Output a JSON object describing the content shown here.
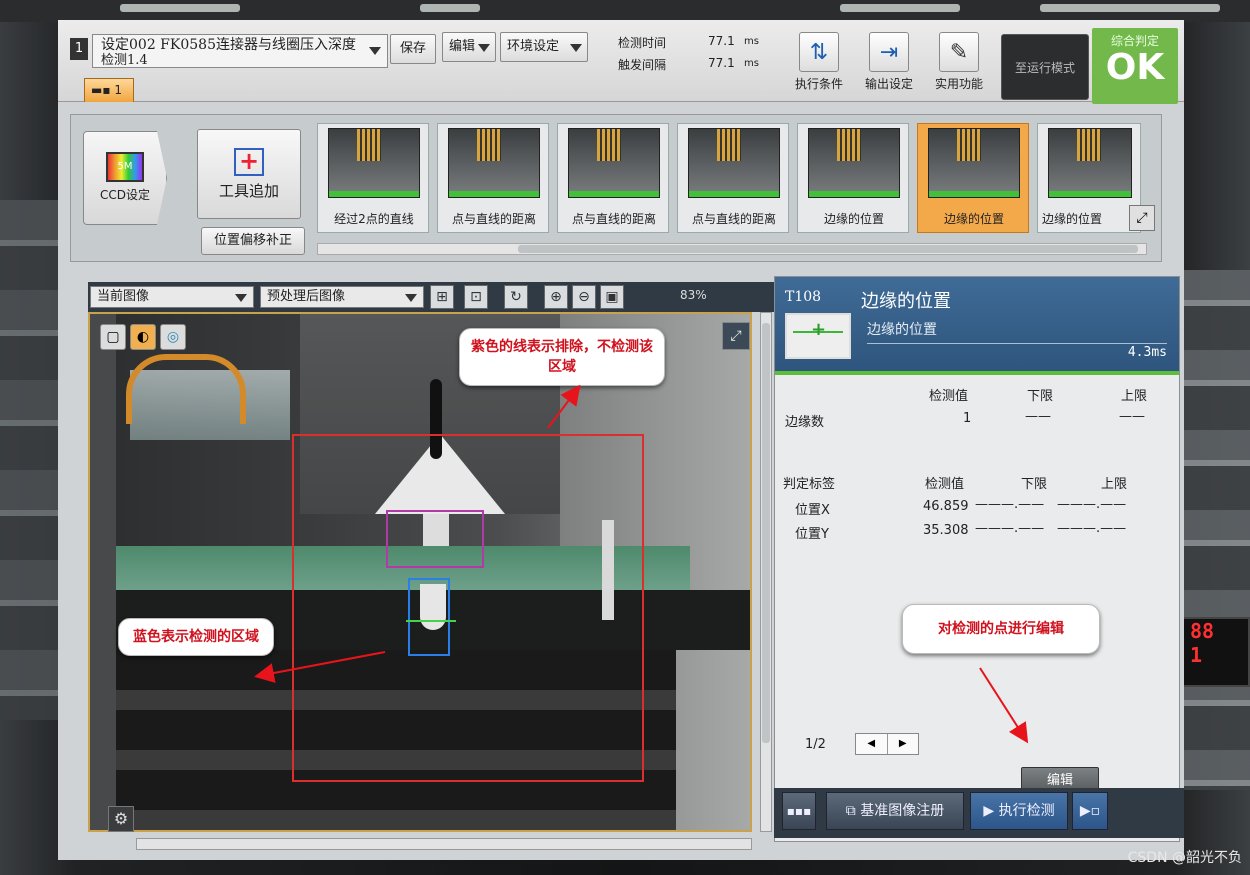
{
  "top": {
    "number": "1",
    "title_line1": "设定002 FK0585连接器与线圈压入深度",
    "title_line2": "检测1.4",
    "save": "保存",
    "edit": "编辑",
    "env": "环境设定",
    "time_label1": "检测时间",
    "time_value1": "77.1",
    "time_unit1": "ms",
    "time_label2": "触发间隔",
    "time_value2": "77.1",
    "time_unit2": "ms",
    "btn_exec_cond": "执行条件",
    "btn_output": "输出设定",
    "btn_utility": "实用功能",
    "run_mode": "至运行模式",
    "judge_label": "综合判定",
    "judge_value": "OK",
    "cam_tab": "1"
  },
  "strip": {
    "ccd_chip": "5M",
    "ccd_label": "CCD设定",
    "tool_add": "工具追加",
    "offset": "位置偏移补正",
    "tools": [
      {
        "label": "经过2点的直线",
        "active": false
      },
      {
        "label": "点与直线的距离",
        "active": false
      },
      {
        "label": "点与直线的距离",
        "active": false
      },
      {
        "label": "点与直线的距离",
        "active": false
      },
      {
        "label": "边缘的位置",
        "active": false
      },
      {
        "label": "边缘的位置",
        "active": true
      },
      {
        "label": "边缘的位置",
        "active": false
      }
    ]
  },
  "image": {
    "source_select": "当前图像",
    "process_select": "预处理后图像",
    "zoom": "83%"
  },
  "callouts": {
    "purple": "紫色的线表示排除，不检测该区域",
    "blue": "蓝色表示检测的区域",
    "edit": "对检测的点进行编辑"
  },
  "panel": {
    "tool_id": "T108",
    "tool_name": "边缘的位置",
    "tool_sub": "边缘的位置",
    "time": "4.3ms",
    "headers1": [
      "检测值",
      "下限",
      "上限"
    ],
    "row_edges": {
      "label": "边缘数",
      "value": "1",
      "low": "——",
      "high": "——"
    },
    "headers2": [
      "判定标签",
      "检测值",
      "下限",
      "上限"
    ],
    "rows": [
      {
        "label": "位置X",
        "value": "46.859",
        "low": "———.——",
        "high": "———.——"
      },
      {
        "label": "位置Y",
        "value": "35.308",
        "low": "———.——",
        "high": "———.——"
      }
    ],
    "page": "1/2",
    "edit_button": "编辑"
  },
  "bottom": {
    "register": "基准图像注册",
    "execute": "执行检测"
  },
  "watermark": "CSDN @韶光不负",
  "machine_display": [
    "88",
    "1"
  ]
}
